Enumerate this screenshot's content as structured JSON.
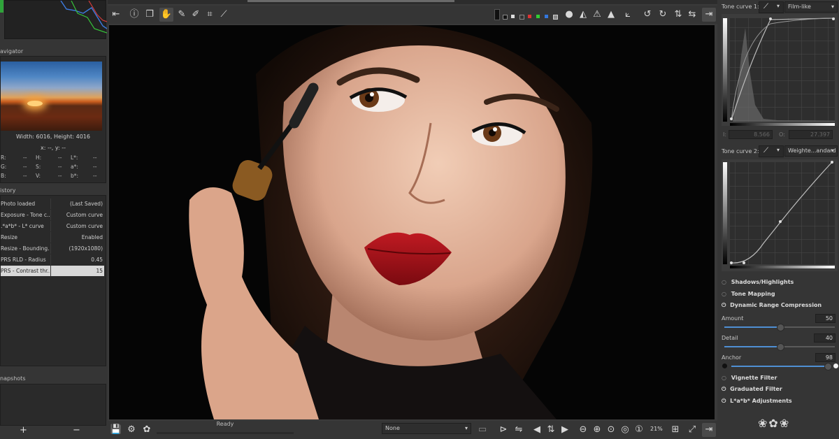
{
  "toolbar": {
    "zoom": "21%"
  },
  "navigator": {
    "title": "avigator",
    "dimensions": "Width: 6016, Height: 4016",
    "coords": "x: --, y: --",
    "readouts": [
      {
        "l": "R:",
        "v": "--"
      },
      {
        "l": "H:",
        "v": "--"
      },
      {
        "l": "L*:",
        "v": "--"
      },
      {
        "l": "G:",
        "v": "--"
      },
      {
        "l": "S:",
        "v": "--"
      },
      {
        "l": "a*:",
        "v": "--"
      },
      {
        "l": "B:",
        "v": "--"
      },
      {
        "l": "V:",
        "v": "--"
      },
      {
        "l": "b*:",
        "v": "--"
      }
    ]
  },
  "history": {
    "title": "istory",
    "items": [
      {
        "action": "Photo loaded",
        "value": "(Last Saved)"
      },
      {
        "action": "Exposure - Tone c...",
        "value": "Custom curve"
      },
      {
        "action": ".*a*b* - L* curve",
        "value": "Custom curve"
      },
      {
        "action": "Resize",
        "value": "Enabled"
      },
      {
        "action": "Resize - Bounding...",
        "value": "(1920x1080)"
      },
      {
        "action": "PRS RLD - Radius",
        "value": "0.45"
      },
      {
        "action": "PRS - Contrast thr...",
        "value": "15"
      }
    ]
  },
  "snapshots": {
    "title": "napshots",
    "add": "+",
    "remove": "−"
  },
  "status": {
    "ready": "Ready",
    "dropdown": "None"
  },
  "tone_curve_1": {
    "label": "Tone curve 1:",
    "mode": "Film-like",
    "b_label": "I:",
    "b_value": "8.566",
    "o_label": "O:",
    "o_value": "27.397"
  },
  "tone_curve_2": {
    "label": "Tone curve 2:",
    "mode": "Weighte...andard"
  },
  "sections": {
    "shadows": "Shadows/Highlights",
    "tone_mapping": "Tone Mapping",
    "drc": "Dynamic Range Compression",
    "vignette": "Vignette Filter",
    "graduated": "Graduated Filter",
    "lab": "L*a*b* Adjustments"
  },
  "drc": {
    "amount_label": "Amount",
    "amount": 50,
    "amount_fraction": 0.5,
    "detail_label": "Detail",
    "detail": 40,
    "detail_fraction": 0.5,
    "anchor_label": "Anchor",
    "anchor": 98,
    "anchor_fraction": 0.98
  },
  "colors": {
    "accent": "#4f8fd3",
    "lips": "#b0141c",
    "skin": "#e5b9a2"
  }
}
